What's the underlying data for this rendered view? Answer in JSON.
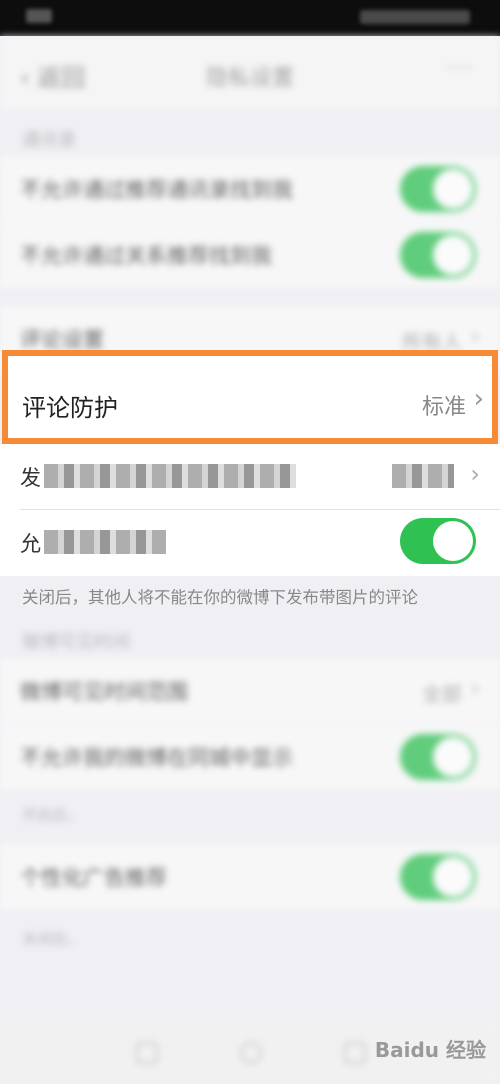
{
  "nav": {
    "back_label": "返回",
    "title": "隐私设置",
    "more": "···"
  },
  "sections": {
    "section1_label": "通讯录",
    "section2_label": "微博可见时间",
    "row1": "不允许通过推荐通讯录找到我",
    "row2": "不允许通过关系推荐找到我",
    "row3_left": "评论设置",
    "row3_right": "所有人",
    "row_comment_protect": "评论防护",
    "row_comment_protect_value": "标准",
    "row5_left": "发",
    "row5_right": "",
    "row6_left": "允",
    "note_photo_comment": "关闭后，其他人将不能在你的微博下发布带图片的评论",
    "row7_left": "微博可见时间范围",
    "row7_right": "全部",
    "row8": "不允许我的微博在同城中显示",
    "row8_note": "开启后，",
    "row9": "个性化广告推荐",
    "row9_note": "关闭后，"
  },
  "watermark": "Baidu 经验",
  "colors": {
    "highlight": "#f58a37",
    "toggle_on": "#2fc253"
  },
  "icons": [
    "back-icon",
    "more-icon",
    "chevron-right-icon",
    "toggle-switch",
    "home-nav-icon"
  ]
}
